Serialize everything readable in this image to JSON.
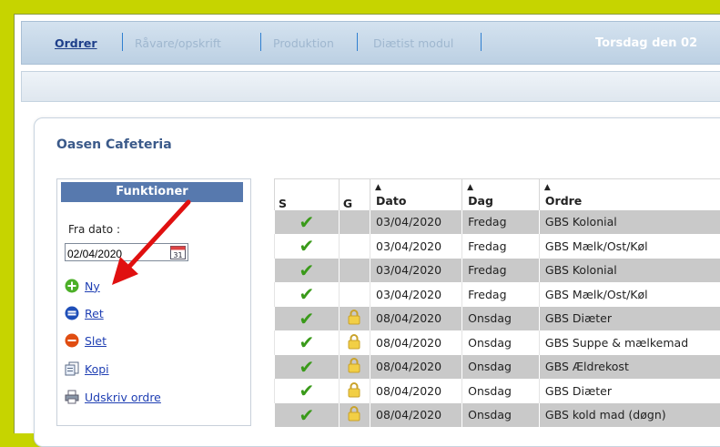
{
  "nav": {
    "items": [
      {
        "label": "Ordrer"
      },
      {
        "label": "Råvare/opskrift"
      },
      {
        "label": "Produktion"
      },
      {
        "label": "Diætist modul"
      }
    ],
    "date_title": "Torsdag den 02"
  },
  "page": {
    "title": "Oasen Cafeteria"
  },
  "functions": {
    "header": "Funktioner",
    "fra_dato_label": "Fra dato :",
    "fra_dato_value": "02/04/2020",
    "calendar_day": "31",
    "links": [
      {
        "label": "Ny",
        "icon": "add-icon"
      },
      {
        "label": "Ret",
        "icon": "edit-icon"
      },
      {
        "label": "Slet",
        "icon": "delete-icon"
      },
      {
        "label": "Kopi",
        "icon": "copy-icon"
      },
      {
        "label": "Udskriv ordre",
        "icon": "printer-icon"
      }
    ]
  },
  "table": {
    "headers": [
      "S",
      "G",
      "Dato",
      "Dag",
      "Ordre"
    ],
    "rows": [
      {
        "s": true,
        "g": false,
        "dato": "03/04/2020",
        "dag": "Fredag",
        "ordre": "GBS Kolonial"
      },
      {
        "s": true,
        "g": false,
        "dato": "03/04/2020",
        "dag": "Fredag",
        "ordre": "GBS Mælk/Ost/Køl"
      },
      {
        "s": true,
        "g": false,
        "dato": "03/04/2020",
        "dag": "Fredag",
        "ordre": "GBS Kolonial"
      },
      {
        "s": true,
        "g": false,
        "dato": "03/04/2020",
        "dag": "Fredag",
        "ordre": "GBS Mælk/Ost/Køl"
      },
      {
        "s": true,
        "g": true,
        "dato": "08/04/2020",
        "dag": "Onsdag",
        "ordre": "GBS Diæter"
      },
      {
        "s": true,
        "g": true,
        "dato": "08/04/2020",
        "dag": "Onsdag",
        "ordre": "GBS Suppe & mælkemad"
      },
      {
        "s": true,
        "g": true,
        "dato": "08/04/2020",
        "dag": "Onsdag",
        "ordre": "GBS Ældrekost"
      },
      {
        "s": true,
        "g": true,
        "dato": "08/04/2020",
        "dag": "Onsdag",
        "ordre": "GBS Diæter"
      },
      {
        "s": true,
        "g": true,
        "dato": "08/04/2020",
        "dag": "Onsdag",
        "ordre": "GBS kold mad (døgn)"
      }
    ]
  },
  "colors": {
    "background": "#c6d400",
    "nav_active": "#1e3f8a",
    "link": "#1f3fb3",
    "header_bg": "#5779ae",
    "odd_row": "#c9c9c9",
    "check": "#3a9a1a",
    "annotation_arrow": "#e01010"
  }
}
